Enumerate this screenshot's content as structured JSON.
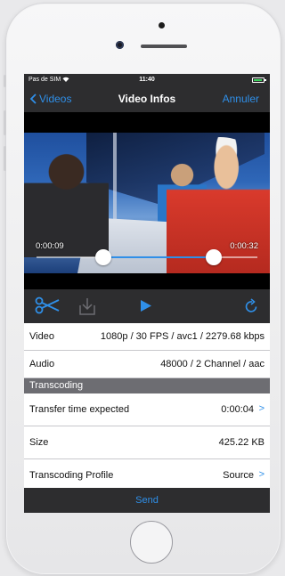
{
  "status_bar": {
    "carrier": "Pas de SIM",
    "time": "11:40"
  },
  "nav": {
    "back_label": "Videos",
    "title": "Video Infos",
    "cancel_label": "Annuler"
  },
  "video": {
    "start_time": "0:00:09",
    "end_time": "0:00:32"
  },
  "toolbar": {
    "icons": [
      "scissors-icon",
      "download-icon",
      "play-icon",
      "rotate-icon"
    ]
  },
  "info": {
    "video": {
      "label": "Video",
      "value": "1080p / 30 FPS / avc1 / 2279.68 kbps"
    },
    "audio": {
      "label": "Audio",
      "value": "48000 / 2 Channel / aac"
    }
  },
  "transcoding": {
    "header": "Transcoding",
    "transfer_time": {
      "label": "Transfer time expected",
      "value": "0:00:04"
    },
    "size": {
      "label": "Size",
      "value": "425.22 KB"
    },
    "profile": {
      "label": "Transcoding Profile",
      "value": "Source"
    }
  },
  "send_label": "Send",
  "colors": {
    "accent": "#2f8fe8",
    "bar": "#2d2d2f",
    "section": "#6d6d72"
  }
}
